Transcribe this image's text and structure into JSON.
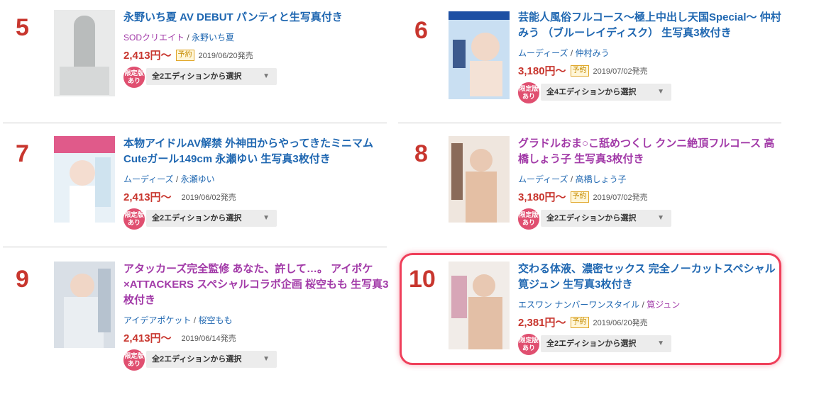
{
  "items": [
    {
      "rank": "5",
      "title": "永野いち夏 AV DEBUT パンティと生写真付き",
      "maker": "SODクリエイト",
      "actress": "永野いち夏",
      "price": "2,413円〜",
      "badge": "予約",
      "date": "2019/06/20発売",
      "limited": "限定版あり",
      "edition": "全2エディションから選択"
    },
    {
      "rank": "6",
      "title": "芸能人風俗フルコース〜極上中出し天国Special〜 仲村みう （ブルーレイディスク） 生写真3枚付き",
      "maker": "ムーディーズ",
      "actress": "仲村みう",
      "price": "3,180円〜",
      "badge": "予約",
      "date": "2019/07/02発売",
      "limited": "限定版あり",
      "edition": "全4エディションから選択"
    },
    {
      "rank": "7",
      "title": "本物アイドルAV解禁 外神田からやってきたミニマムCuteガール149cm 永瀬ゆい 生写真3枚付き",
      "maker": "ムーディーズ",
      "actress": "永瀬ゆい",
      "price": "2,413円〜",
      "badge": "",
      "date": "2019/06/02発売",
      "limited": "限定版あり",
      "edition": "全2エディションから選択"
    },
    {
      "rank": "8",
      "title": "グラドルおま○こ舐めつくし クンニ絶頂フルコース 高橋しょう子 生写真3枚付き",
      "maker": "ムーディーズ",
      "actress": "高橋しょう子",
      "price": "3,180円〜",
      "badge": "予約",
      "date": "2019/07/02発売",
      "limited": "限定版あり",
      "edition": "全2エディションから選択"
    },
    {
      "rank": "9",
      "title": "アタッカーズ完全監修 あなた、許して…。 アイポケ×ATTACKERS スペシャルコラボ企画 桜空もも 生写真3枚付き",
      "maker": "アイデアポケット",
      "actress": "桜空もも",
      "price": "2,413円〜",
      "badge": "",
      "date": "2019/06/14発売",
      "limited": "限定版あり",
      "edition": "全2エディションから選択"
    },
    {
      "rank": "10",
      "title": "交わる体液、濃密セックス 完全ノーカットスペシャル 筧ジュン 生写真3枚付き",
      "maker": "エスワン ナンバーワンスタイル",
      "actress": "筧ジュン",
      "price": "2,381円〜",
      "badge": "予約",
      "date": "2019/06/20発売",
      "limited": "限定版あり",
      "edition": "全2エディションから選択"
    }
  ],
  "separator": "/",
  "arrow": "▼"
}
